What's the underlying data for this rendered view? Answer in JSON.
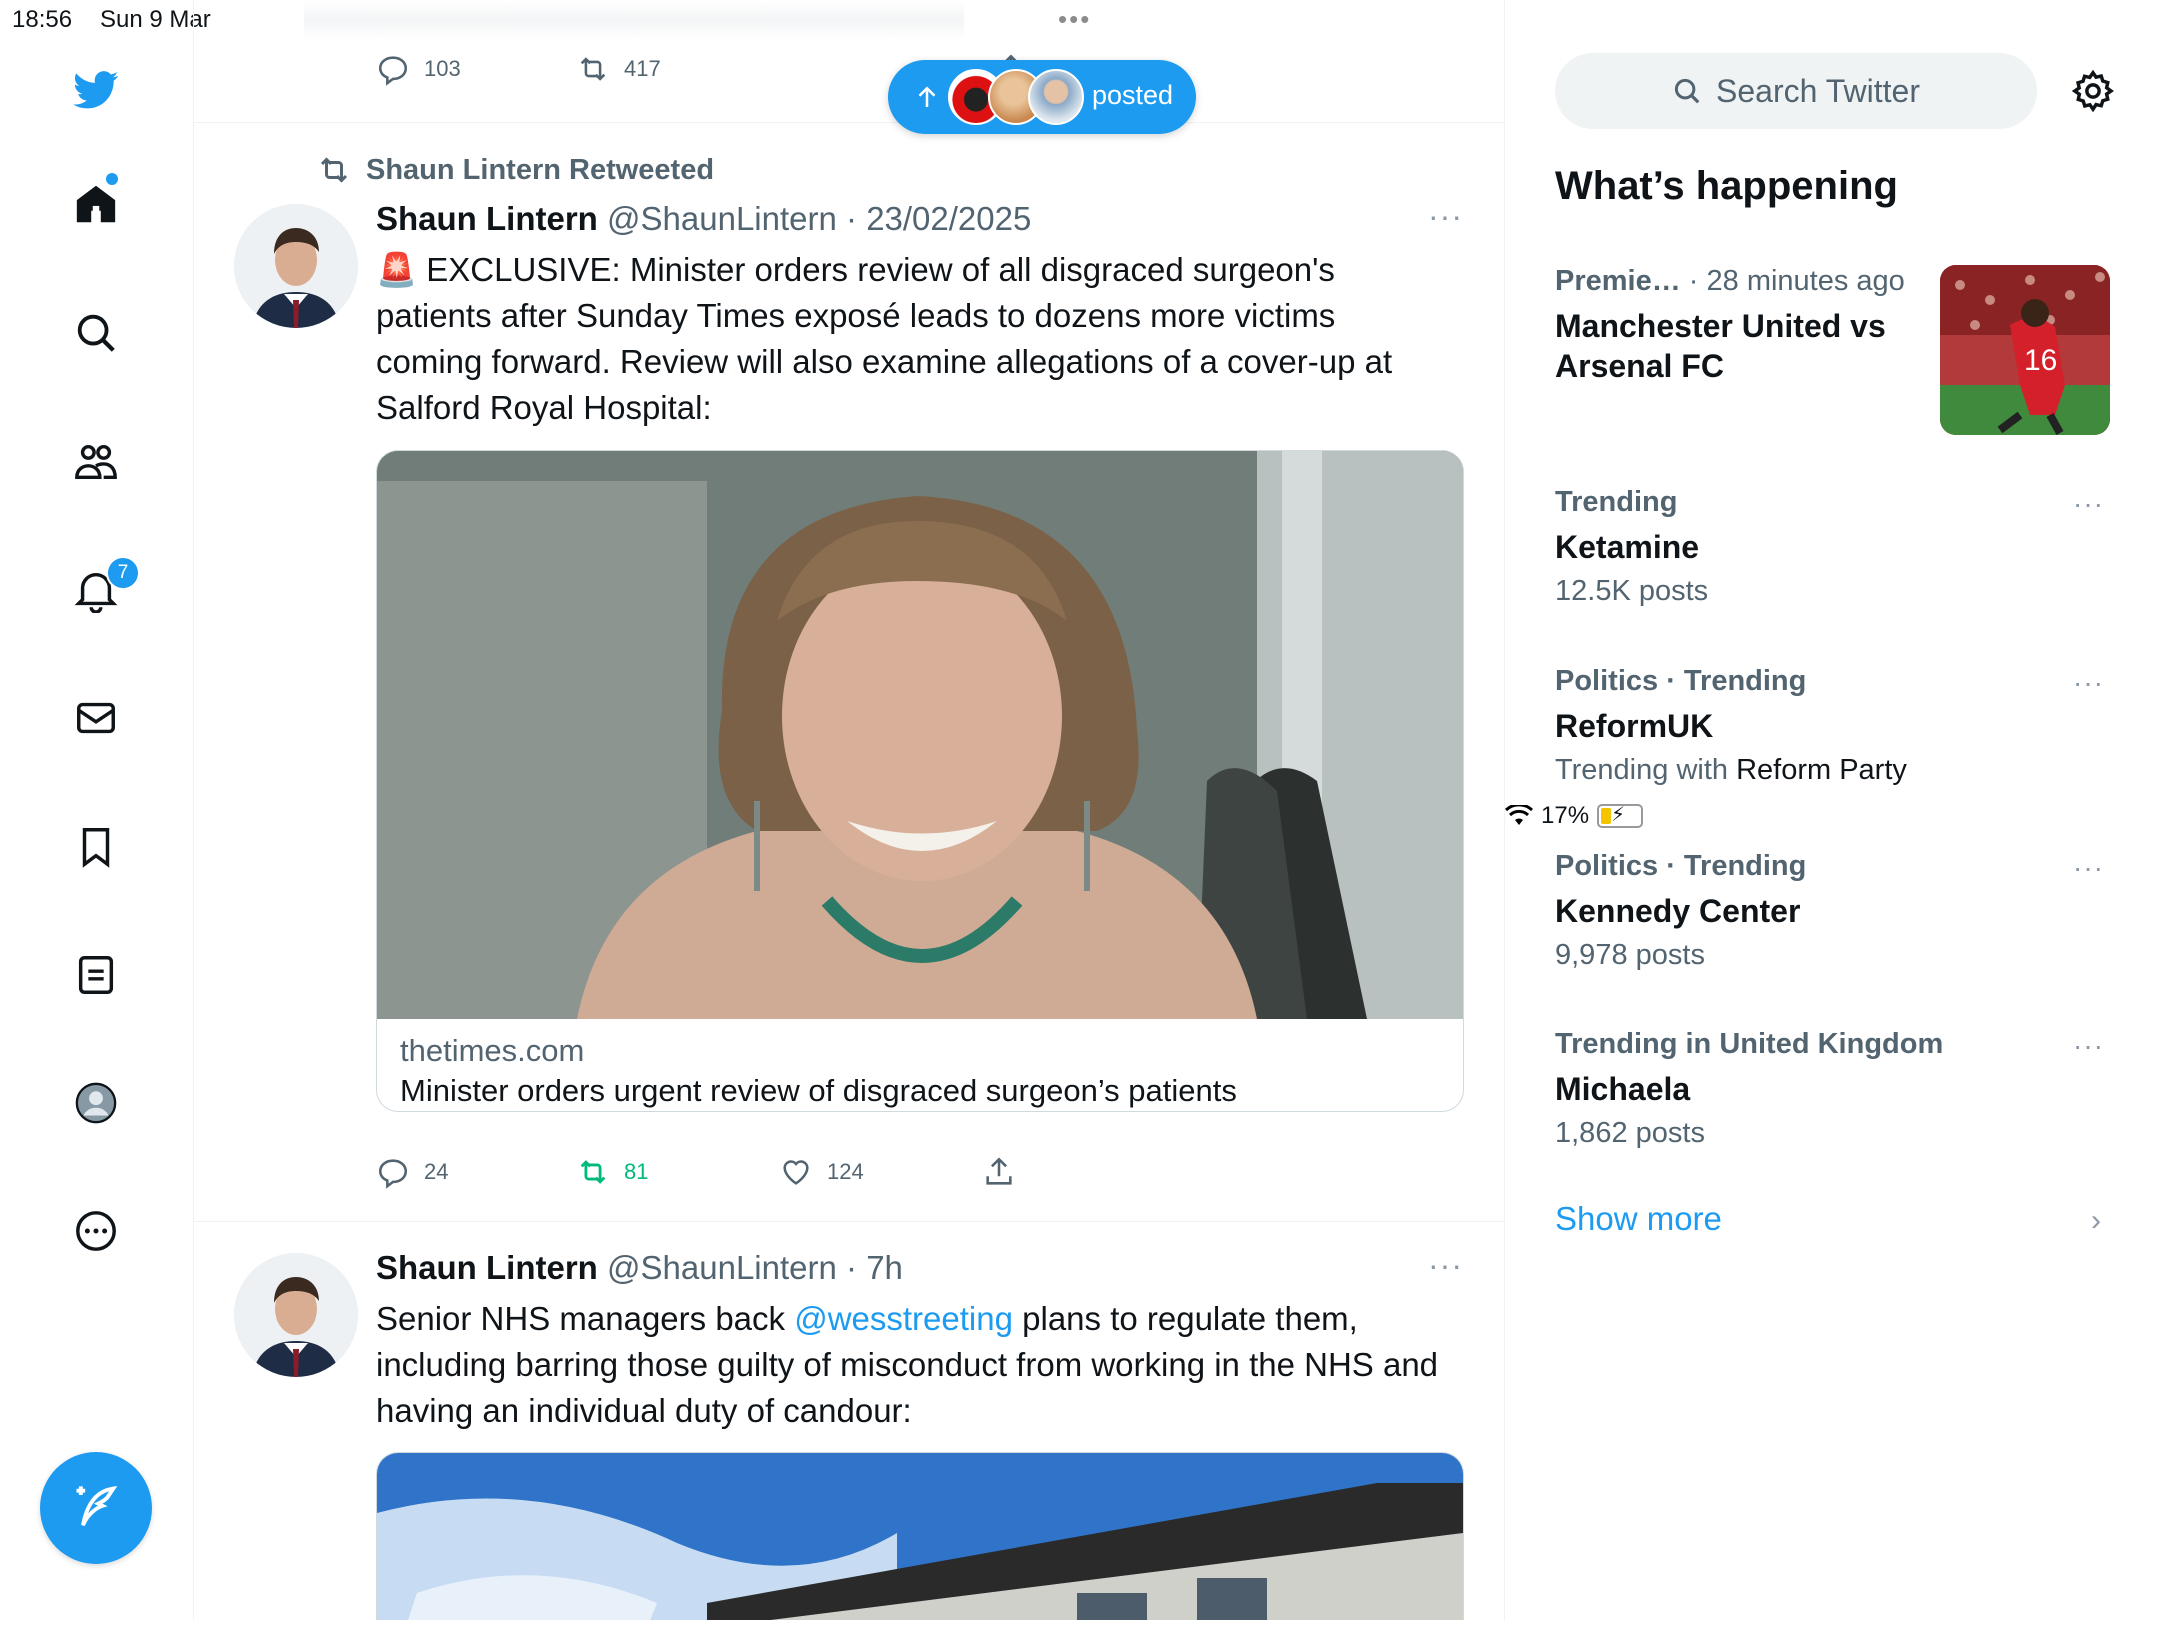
{
  "status_bar": {
    "time": "18:56",
    "date": "Sun 9 Mar",
    "battery": "17%"
  },
  "nav": {
    "notification_count": "7",
    "items": [
      "home",
      "explore",
      "communities",
      "notifications",
      "messages",
      "bookmarks",
      "lists",
      "profile",
      "more"
    ]
  },
  "feed": {
    "prev_tweet": {
      "replies": "103",
      "retweets": "417"
    },
    "posted_pill": {
      "label": "posted"
    },
    "tweet1": {
      "retweeted_by": "Shaun Lintern Retweeted",
      "name": "Shaun Lintern",
      "handle": "@ShaunLintern",
      "date": "23/02/2025",
      "text": "🚨 EXCLUSIVE: Minister orders review of all disgraced surgeon's patients after Sunday Times exposé leads to dozens more victims coming forward. Review will also examine allegations of a cover-up at Salford Royal Hospital:",
      "card": {
        "domain": "thetimes.com",
        "title": "Minister orders urgent review of disgraced surgeon’s patients"
      },
      "replies": "24",
      "retweets": "81",
      "likes": "124"
    },
    "tweet2": {
      "name": "Shaun Lintern",
      "handle": "@ShaunLintern",
      "time": "7h",
      "text_before": "Senior NHS managers back ",
      "mention": "@wesstreeting",
      "text_after": " plans to regulate them, including barring those guilty of misconduct from working in the NHS and having an individual duty of candour:"
    }
  },
  "sidebar": {
    "search_placeholder": "Search Twitter",
    "heading": "What’s happening",
    "trends": [
      {
        "category": "Premie…",
        "time": "· 28 minutes ago",
        "topic": "Manchester United vs Arsenal FC"
      },
      {
        "category": "Trending",
        "topic": "Ketamine",
        "posts": "12.5K posts"
      },
      {
        "category": "Politics · Trending",
        "topic": "ReformUK",
        "posts_prefix": "Trending with ",
        "posts_link": "Reform Party"
      },
      {
        "category": "Politics · Trending",
        "topic": "Kennedy Center",
        "posts": "9,978 posts"
      },
      {
        "category": "Trending in United Kingdom",
        "topic": "Michaela",
        "posts": "1,862 posts"
      }
    ],
    "show_more": "Show more"
  },
  "colors": {
    "accent": "#1d9bf0",
    "retweet_green": "#00ba7c",
    "text": "#0f1419",
    "muted": "#536471"
  }
}
